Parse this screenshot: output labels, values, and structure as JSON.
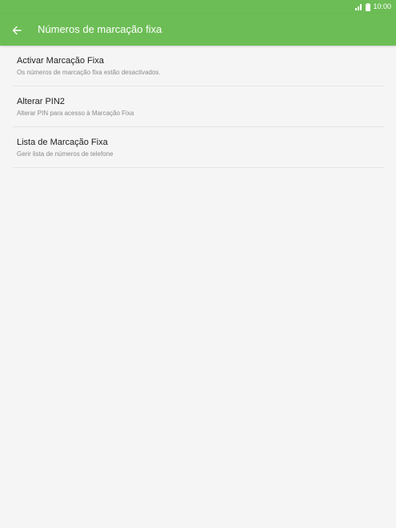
{
  "status_bar": {
    "time": "10:00",
    "signal_icon": "signal-icon",
    "battery_icon": "battery-icon"
  },
  "app_bar": {
    "back_icon": "back-arrow-icon",
    "title": "Números de marcação fixa",
    "color": "#6cbd55"
  },
  "settings": {
    "items": [
      {
        "title": "Activar Marcação Fixa",
        "subtitle": "Os números de marcação fixa estão desactivados."
      },
      {
        "title": "Alterar PIN2",
        "subtitle": "Alterar PIN para acesso à Marcação Fixa"
      },
      {
        "title": "Lista de Marcação Fixa",
        "subtitle": "Gerir lista de números de telefone"
      }
    ]
  }
}
